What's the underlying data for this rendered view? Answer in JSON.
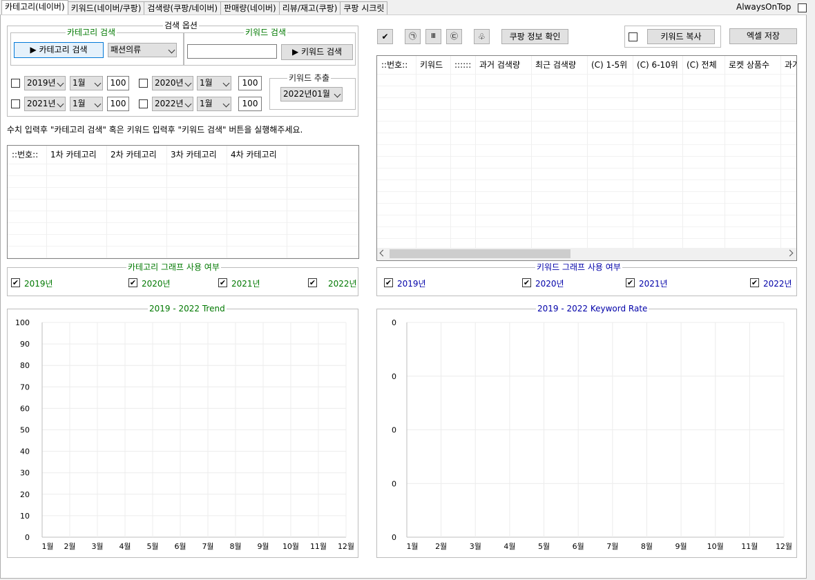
{
  "tabs": [
    "카테고리(네이버)",
    "키워드(네이버/쿠팡)",
    "검색량(쿠팡/네이버)",
    "판매량(네이버)",
    "리뷰/재고(쿠팡)",
    "쿠팡 시크릿"
  ],
  "always_on_top": "AlwaysOnTop",
  "search_options": {
    "title": "검색 옵션",
    "category_search": {
      "title": "카테고리 검색",
      "button": "▶ 카테고리 검색",
      "category_value": "패션의류"
    },
    "keyword_search": {
      "title": "키워드 검색",
      "input_value": "",
      "button": "▶ 키워드 검색"
    },
    "year_rows": [
      {
        "year": "2019년",
        "month": "1월",
        "count": "100"
      },
      {
        "year": "2020년",
        "month": "1월",
        "count": "100"
      },
      {
        "year": "2021년",
        "month": "1월",
        "count": "100"
      },
      {
        "year": "2022년",
        "month": "1월",
        "count": "100"
      }
    ],
    "keyword_extract": {
      "title": "키워드 추출",
      "value": "2022년01월"
    }
  },
  "instruction": "수치 입력후 \"카테고리 검색\" 혹은 키워드 입력후 \"키워드 검색\" 버튼을 실행해주세요.",
  "category_grid": {
    "columns": [
      "::번호::",
      "1차 카테고리",
      "2차 카테고리",
      "3차 카테고리",
      "4차 카테고리"
    ]
  },
  "toolbar": {
    "icon_buttons": [
      "✔",
      "㉠",
      "Ⅲ",
      "㉢",
      "♧"
    ],
    "coupang_info": "쿠팡 정보 확인",
    "keyword_copy": "키워드 복사",
    "excel_save": "엑셀 저장"
  },
  "keyword_grid": {
    "columns": [
      "::번호::",
      "키워드",
      "::::::",
      "과거 검색량",
      "최근 검색량",
      "(C) 1-5위",
      "(C) 6-10위",
      "(C) 전체",
      "로켓 상품수",
      "과거"
    ]
  },
  "category_graph_usage": {
    "title": "카테고리 그래프 사용 여부",
    "years": [
      "2019년",
      "2020년",
      "2021년",
      "2022년"
    ],
    "checked": [
      true,
      true,
      true,
      true
    ]
  },
  "keyword_graph_usage": {
    "title": "키워드 그래프 사용 여부",
    "years": [
      "2019년",
      "2020년",
      "2021년",
      "2022년"
    ],
    "checked": [
      true,
      true,
      true,
      true
    ]
  },
  "chart_data": [
    {
      "type": "line",
      "title": "2019 - 2022 Trend",
      "x": [
        "1월",
        "2월",
        "3월",
        "4월",
        "5월",
        "6월",
        "7월",
        "8월",
        "9월",
        "10월",
        "11월",
        "12월"
      ],
      "series": [],
      "ylim": [
        0,
        100
      ],
      "yticks": [
        "100",
        "90",
        "80",
        "70",
        "60",
        "50",
        "40",
        "30",
        "20",
        "10",
        "0"
      ],
      "grid": true
    },
    {
      "type": "line",
      "title": "2019 - 2022 Keyword Rate",
      "x": [
        "1월",
        "2월",
        "3월",
        "4월",
        "5월",
        "6월",
        "7월",
        "8월",
        "9월",
        "10월",
        "11월",
        "12월"
      ],
      "series": [],
      "yticks": [
        "0",
        "0",
        "0",
        "0",
        "0"
      ],
      "grid": true
    }
  ],
  "colors": {
    "green": "#007800",
    "blue": "#0000a8"
  }
}
